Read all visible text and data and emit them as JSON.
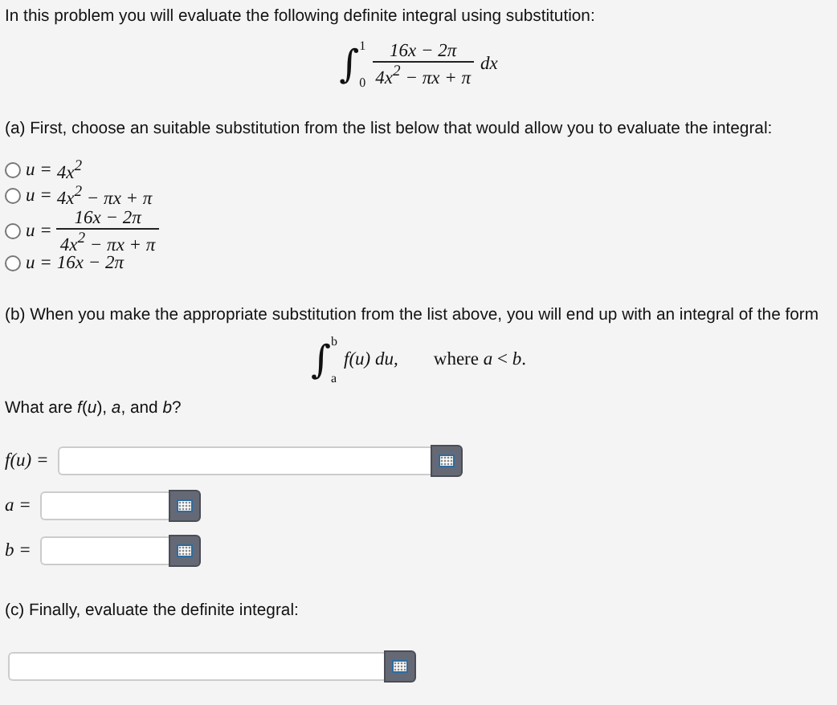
{
  "intro": "In this problem you will evaluate the following definite integral using substitution:",
  "integral": {
    "symbol": "∫",
    "lower": "0",
    "upper": "1",
    "numerator": "16x − 2π",
    "denominator": "4x$^{2}$ − πx + π",
    "differential": "dx"
  },
  "part_a": {
    "prompt": "(a) First, choose an suitable substitution from the list below that would allow you to evaluate the integral:",
    "options": [
      {
        "kind": "inline",
        "selected": false,
        "lhs": "u =",
        "expr": "4x$^{2}$"
      },
      {
        "kind": "inline",
        "selected": false,
        "lhs": "u =",
        "expr": "4x$^{2}$ − πx + π"
      },
      {
        "kind": "fraction",
        "selected": false,
        "lhs": "u =",
        "numerator": "16x − 2π",
        "denominator": "4x$^{2}$ − πx + π"
      },
      {
        "kind": "inline",
        "selected": false,
        "lhs": "u =",
        "expr": "16x − 2π"
      }
    ]
  },
  "part_b": {
    "prompt": "(b) When you make the appropriate substitution from the list above, you will end up with an integral of the form",
    "form": {
      "symbol": "∫",
      "lower": "a",
      "upper": "b",
      "integrand": "f(u) du,",
      "condition": "where *a* < *b*."
    },
    "question": "What are *f*(*u*), *a*, and *b*?",
    "fields": [
      {
        "kind": "wide",
        "label": "f(u) ="
      },
      {
        "kind": "narrow",
        "label": "a ="
      },
      {
        "kind": "narrow",
        "label": "b ="
      }
    ]
  },
  "part_c": {
    "prompt": "(c) Finally, evaluate the definite integral:"
  }
}
